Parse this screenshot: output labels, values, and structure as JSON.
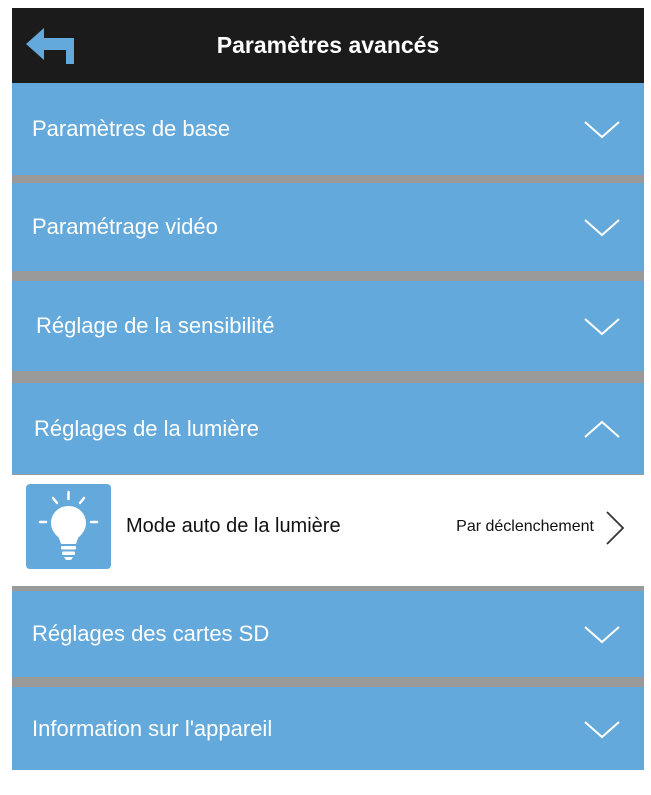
{
  "header": {
    "title": "Paramètres avancés",
    "back_icon": "back-arrow-icon",
    "background": "#1b1b1b"
  },
  "sections": [
    {
      "label": "Paramètres de base",
      "expanded": false,
      "icon": "chevron-down-icon"
    },
    {
      "label": "Paramétrage vidéo",
      "expanded": false,
      "icon": "chevron-down-icon"
    },
    {
      "label": "Réglage de la sensibilité",
      "expanded": false,
      "icon": "chevron-down-icon"
    },
    {
      "label": "Réglages de la lumière",
      "expanded": true,
      "icon": "chevron-up-icon"
    },
    {
      "label": "Réglages des cartes SD",
      "expanded": false,
      "icon": "chevron-down-icon"
    },
    {
      "label": "Information sur l'appareil",
      "expanded": false,
      "icon": "chevron-down-icon"
    }
  ],
  "light_settings": {
    "items": [
      {
        "label": "Mode auto de la lumière",
        "value": "Par déclenchement",
        "icon": "lightbulb-icon"
      }
    ]
  },
  "colors": {
    "section_background": "#64a9db",
    "separator": "#9a9a9a",
    "item_background": "#ffffff"
  }
}
